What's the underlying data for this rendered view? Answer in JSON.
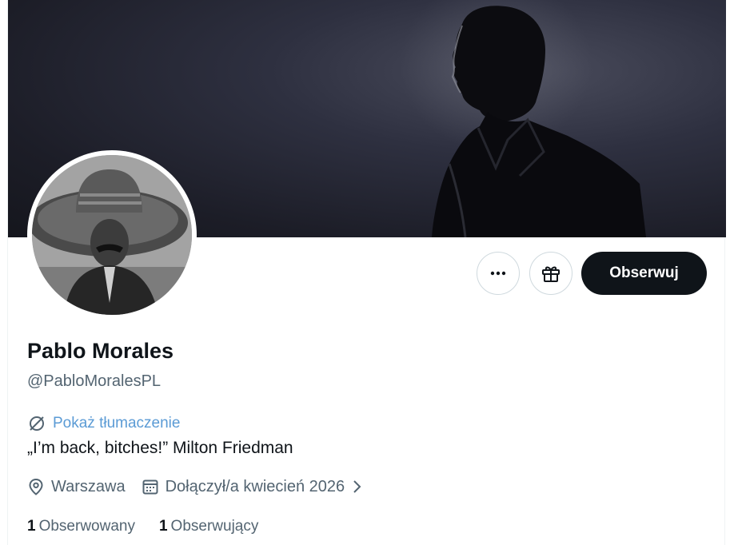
{
  "profile": {
    "name": "Pablo Morales",
    "handle": "@PabloMoralesPL",
    "bio": "„I’m back, bitches!” Milton Friedman",
    "location": "Warszawa",
    "joined": "Dołączył/a kwiecień 2026"
  },
  "actions": {
    "more_icon": "more-horizontal-icon",
    "gift_icon": "gift-icon",
    "follow_label": "Obserwuj"
  },
  "translate": {
    "icon": "translate-icon",
    "label": "Pokaż tłumaczenie"
  },
  "stats": {
    "following_count": "1",
    "following_label": "Obserwowany",
    "followers_count": "1",
    "followers_label": "Obserwujący"
  },
  "colors": {
    "primary_text": "#0f1419",
    "secondary_text": "#536471",
    "link": "#5b9bd5",
    "follow_button": "#0f1419",
    "border": "#cfd9de"
  }
}
